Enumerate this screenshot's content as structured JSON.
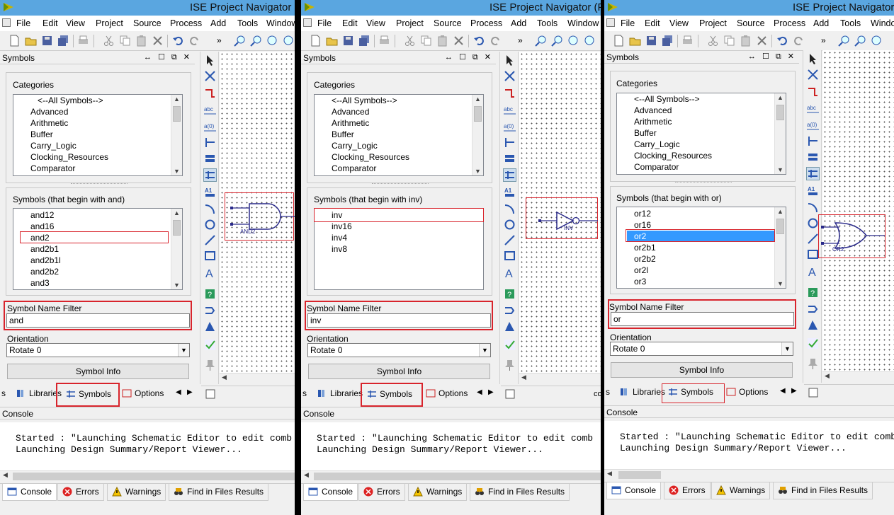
{
  "title": "ISE Project Navigator (",
  "menu": [
    "File",
    "Edit",
    "View",
    "Project",
    "Source",
    "Process",
    "Add",
    "Tools",
    "Window"
  ],
  "symbols_panel": {
    "title": "Symbols",
    "controls": "↔ ☐ ⧉ ✕",
    "categories_label": "Categories",
    "categories": [
      "<--All Symbols-->",
      "Advanced",
      "Arithmetic",
      "Buffer",
      "Carry_Logic",
      "Clocking_Resources",
      "Comparator"
    ],
    "filter_label": "Symbol Name Filter",
    "orientation_label": "Orientation",
    "orientation_value": "Rotate 0",
    "symbol_info_label": "Symbol Info"
  },
  "panels": [
    {
      "title_text": "ISE Project Navigator (",
      "symbols_label": "Symbols (that begin with and)",
      "symbols": [
        "and12",
        "and16",
        "and2",
        "and2b1",
        "and2b1l",
        "and2b2",
        "and3"
      ],
      "selected_index": 2,
      "filter_value": "and",
      "preview_label": "AND2",
      "tab_left": "s"
    },
    {
      "title_text": "ISE Project Navigator (P",
      "symbols_label": "Symbols (that begin with inv)",
      "symbols": [
        "inv",
        "inv16",
        "inv4",
        "inv8"
      ],
      "selected_index": 0,
      "filter_value": "inv",
      "preview_label": "INV",
      "tab_left": "s"
    },
    {
      "title_text": "ISE Project Navigator",
      "symbols_label": "Symbols (that begin with or)",
      "symbols": [
        "or12",
        "or16",
        "or2",
        "or2b1",
        "or2b2",
        "or2l",
        "or3"
      ],
      "selected_index": 2,
      "filter_value": "or",
      "preview_label": "OR2",
      "tab_left": "s"
    }
  ],
  "bottom_tabs": [
    "Libraries",
    "Symbols",
    "Options"
  ],
  "canvas_tab_tail": "co",
  "console": {
    "title": "Console",
    "lines": [
      "Started : \"Launching Schematic Editor to edit comb",
      "Launching Design Summary/Report Viewer..."
    ],
    "tabs": [
      "Console",
      "Errors",
      "Warnings",
      "Find in Files Results"
    ]
  },
  "colors": {
    "titlebar": "#5aa6e0",
    "selection": "#3399ff",
    "highlight_red": "#d8242c"
  }
}
